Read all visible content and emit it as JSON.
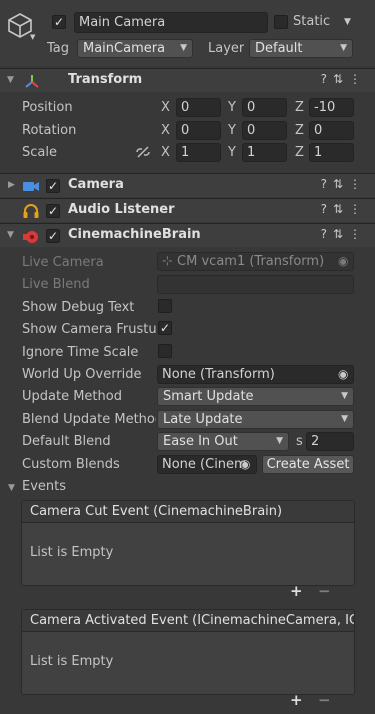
{
  "object": {
    "name": "Main Camera",
    "static_label": "Static",
    "tag_label": "Tag",
    "tag_value": "MainCamera",
    "layer_label": "Layer",
    "layer_value": "Default"
  },
  "transform": {
    "title": "Transform",
    "position": {
      "label": "Position",
      "x": "0",
      "y": "0",
      "z": "-10"
    },
    "rotation": {
      "label": "Rotation",
      "x": "0",
      "y": "0",
      "z": "0"
    },
    "scale": {
      "label": "Scale",
      "x": "1",
      "y": "1",
      "z": "1"
    },
    "axis_x": "X",
    "axis_y": "Y",
    "axis_z": "Z"
  },
  "components": {
    "camera": "Camera",
    "audio_listener": "Audio Listener",
    "cinemachine_brain": "CinemachineBrain"
  },
  "brain": {
    "live_camera_label": "Live Camera",
    "live_camera_value": "CM vcam1 (Transform)",
    "live_blend_label": "Live Blend",
    "show_debug_text_label": "Show Debug Text",
    "show_camera_frustum_label": "Show Camera Frustum",
    "ignore_time_scale_label": "Ignore Time Scale",
    "world_up_override_label": "World Up Override",
    "world_up_override_value": "None (Transform)",
    "update_method_label": "Update Method",
    "update_method_value": "Smart Update",
    "blend_update_method_label": "Blend Update Method",
    "blend_update_method_value": "Late Update",
    "default_blend_label": "Default Blend",
    "default_blend_value": "Ease In Out",
    "default_blend_unit": "s",
    "default_blend_time": "2",
    "custom_blends_label": "Custom Blends",
    "custom_blends_value": "None (Cinem",
    "create_asset_label": "Create Asset",
    "events_label": "Events",
    "camera_cut_event": "Camera Cut Event (CinemachineBrain)",
    "camera_activated_event": "Camera Activated Event (ICinemachineCamera, IC",
    "list_empty": "List is Empty",
    "add_symbol": "+",
    "remove_symbol": "−"
  },
  "icons": {
    "checkmark": "✓",
    "caret": "▼",
    "expanded": "▼",
    "collapsed": "▶",
    "help": "?",
    "settings": "⇅",
    "menu": "⋮",
    "target": "◉"
  }
}
